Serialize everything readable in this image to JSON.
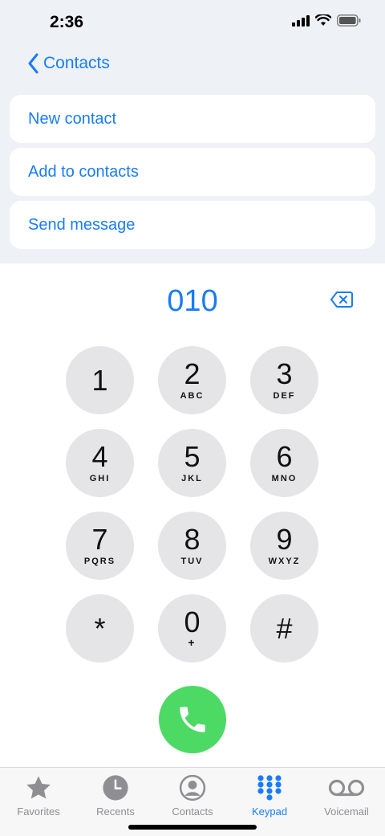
{
  "status": {
    "time": "2:36"
  },
  "nav": {
    "back_label": "Contacts"
  },
  "actions": [
    {
      "label": "New contact"
    },
    {
      "label": "Add to contacts"
    },
    {
      "label": "Send message"
    }
  ],
  "dialer": {
    "number": "010",
    "keys": [
      {
        "digit": "1",
        "letters": ""
      },
      {
        "digit": "2",
        "letters": "ABC"
      },
      {
        "digit": "3",
        "letters": "DEF"
      },
      {
        "digit": "4",
        "letters": "GHI"
      },
      {
        "digit": "5",
        "letters": "JKL"
      },
      {
        "digit": "6",
        "letters": "MNO"
      },
      {
        "digit": "7",
        "letters": "PQRS"
      },
      {
        "digit": "8",
        "letters": "TUV"
      },
      {
        "digit": "9",
        "letters": "WXYZ"
      },
      {
        "digit": "*",
        "letters": ""
      },
      {
        "digit": "0",
        "letters": "+"
      },
      {
        "digit": "#",
        "letters": ""
      }
    ]
  },
  "tabs": [
    {
      "label": "Favorites",
      "icon": "star-icon"
    },
    {
      "label": "Recents",
      "icon": "clock-icon"
    },
    {
      "label": "Contacts",
      "icon": "person-circle-icon"
    },
    {
      "label": "Keypad",
      "icon": "keypad-icon",
      "active": true
    },
    {
      "label": "Voicemail",
      "icon": "voicemail-icon"
    }
  ],
  "colors": {
    "accent": "#1a7cf5",
    "call": "#4cd964",
    "key": "#e5e5e7",
    "tab_inactive": "#8e8e93"
  }
}
